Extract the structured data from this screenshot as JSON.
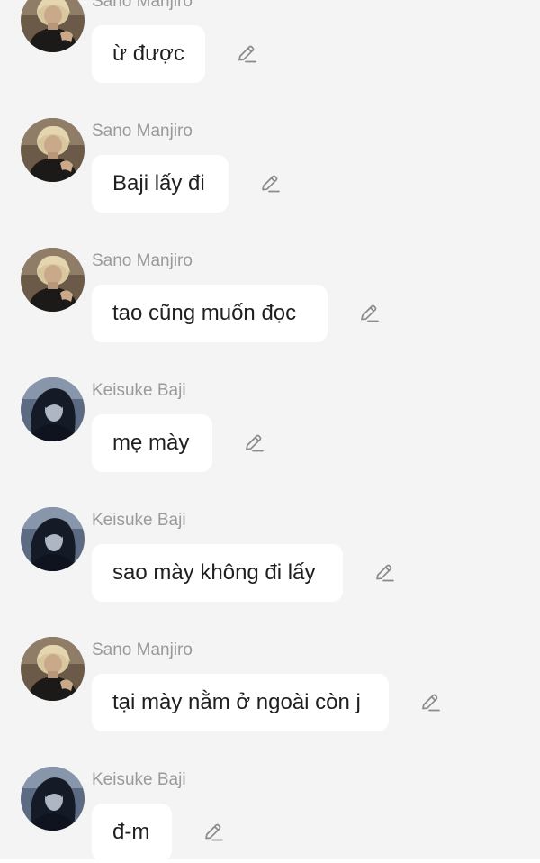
{
  "colors": {
    "background": "#f4f4f4",
    "bubble": "#ffffff",
    "sender_name": "#9a9a9a",
    "message_text": "#1f1f1f",
    "edit_icon": "#8a8a8a"
  },
  "messages": [
    {
      "sender": "Sano Manjiro",
      "text": "ừ được",
      "avatar": "sano-avatar",
      "edit_icon": "pencil-icon"
    },
    {
      "sender": "Sano Manjiro",
      "text": "Baji lấy đi",
      "avatar": "sano-avatar",
      "edit_icon": "pencil-icon"
    },
    {
      "sender": "Sano Manjiro",
      "text": "tao cũng muốn đọc",
      "avatar": "sano-avatar",
      "edit_icon": "pencil-icon"
    },
    {
      "sender": "Keisuke Baji",
      "text": "mẹ mày",
      "avatar": "baji-avatar",
      "edit_icon": "pencil-icon"
    },
    {
      "sender": "Keisuke Baji",
      "text": "sao mày không đi lấy",
      "avatar": "baji-avatar",
      "edit_icon": "pencil-icon"
    },
    {
      "sender": "Sano Manjiro",
      "text": "tại mày nằm ở ngoài còn j",
      "avatar": "sano-avatar",
      "edit_icon": "pencil-icon"
    },
    {
      "sender": "Keisuke Baji",
      "text": "đ-m",
      "avatar": "baji-avatar",
      "edit_icon": "pencil-icon"
    }
  ]
}
